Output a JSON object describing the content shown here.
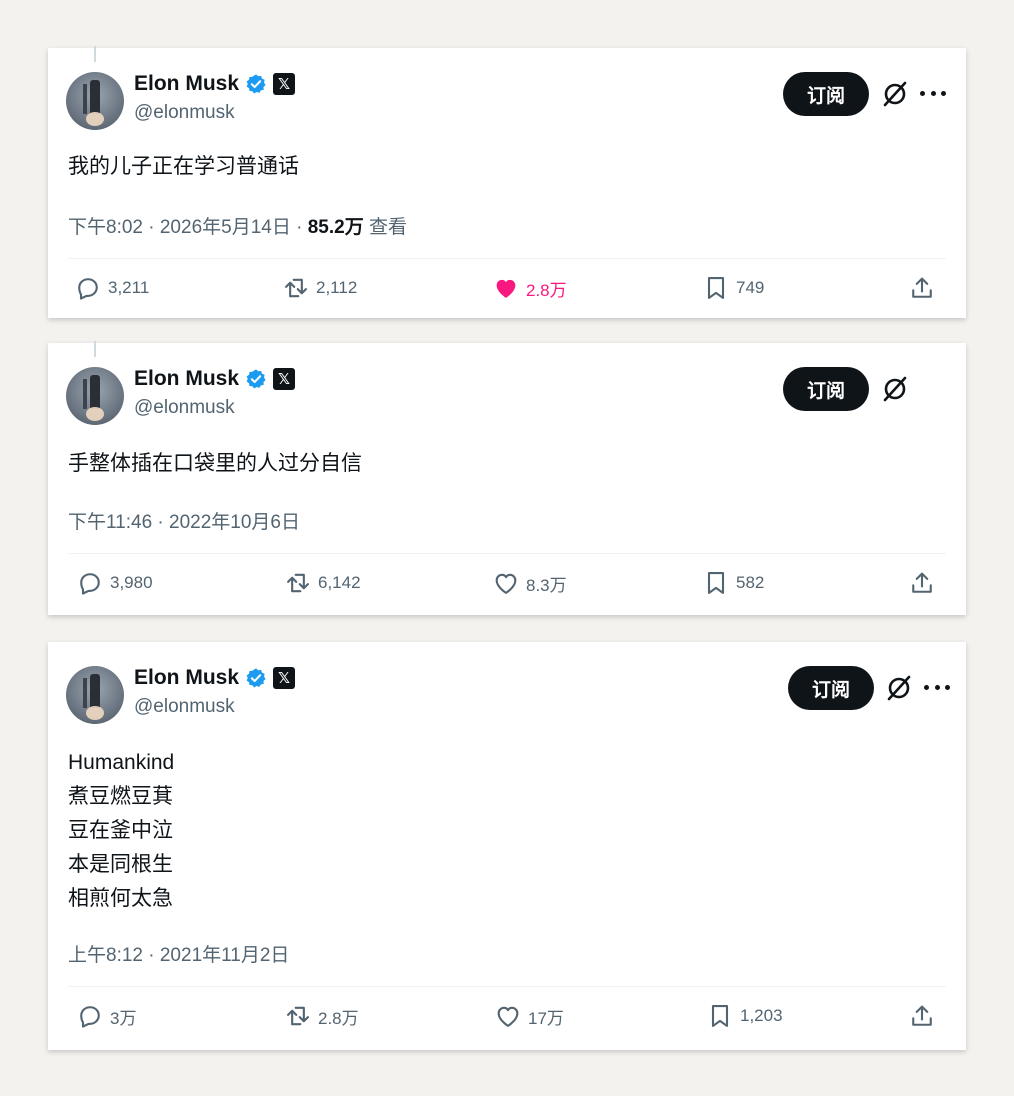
{
  "tweets": [
    {
      "name": "Elon Musk",
      "handle": "@elonmusk",
      "subscribe": "订阅",
      "text_lines": [
        "我的儿子正在学习普通话"
      ],
      "time": "下午8:02 · 2026年5月14日 · ",
      "views": "85.2万",
      "views_label": " 查看",
      "replies": "3,211",
      "reposts": "2,112",
      "likes": "2.8万",
      "bookmarks": "749",
      "liked": true,
      "has_more": true
    },
    {
      "name": "Elon Musk",
      "handle": "@elonmusk",
      "subscribe": "订阅",
      "text_lines": [
        "手整体插在口袋里的人过分自信"
      ],
      "time": "下午11:46 · 2022年10月6日",
      "replies": "3,980",
      "reposts": "6,142",
      "likes": "8.3万",
      "bookmarks": "582",
      "liked": false,
      "has_more": false
    },
    {
      "name": "Elon Musk",
      "handle": "@elonmusk",
      "subscribe": "订阅",
      "text_lines": [
        "Humankind",
        "煮豆燃豆萁",
        "豆在釜中泣",
        "本是同根生",
        "相煎何太急"
      ],
      "time": "上午8:12 · 2021年11月2日",
      "replies": "3万",
      "reposts": "2.8万",
      "likes": "17万",
      "bookmarks": "1,203",
      "liked": false,
      "has_more": true
    }
  ],
  "icons": {
    "verified": "verified-badge-icon",
    "x_logo": "x-logo-icon",
    "grok": "grok-icon",
    "more": "more-icon",
    "reply": "reply-icon",
    "repost": "repost-icon",
    "like": "heart-icon",
    "bookmark": "bookmark-icon",
    "share": "share-icon"
  },
  "colors": {
    "verified_blue": "#1d9bf0",
    "like_pink": "#f91880",
    "text_primary": "#0f1419",
    "text_secondary": "#536471"
  }
}
